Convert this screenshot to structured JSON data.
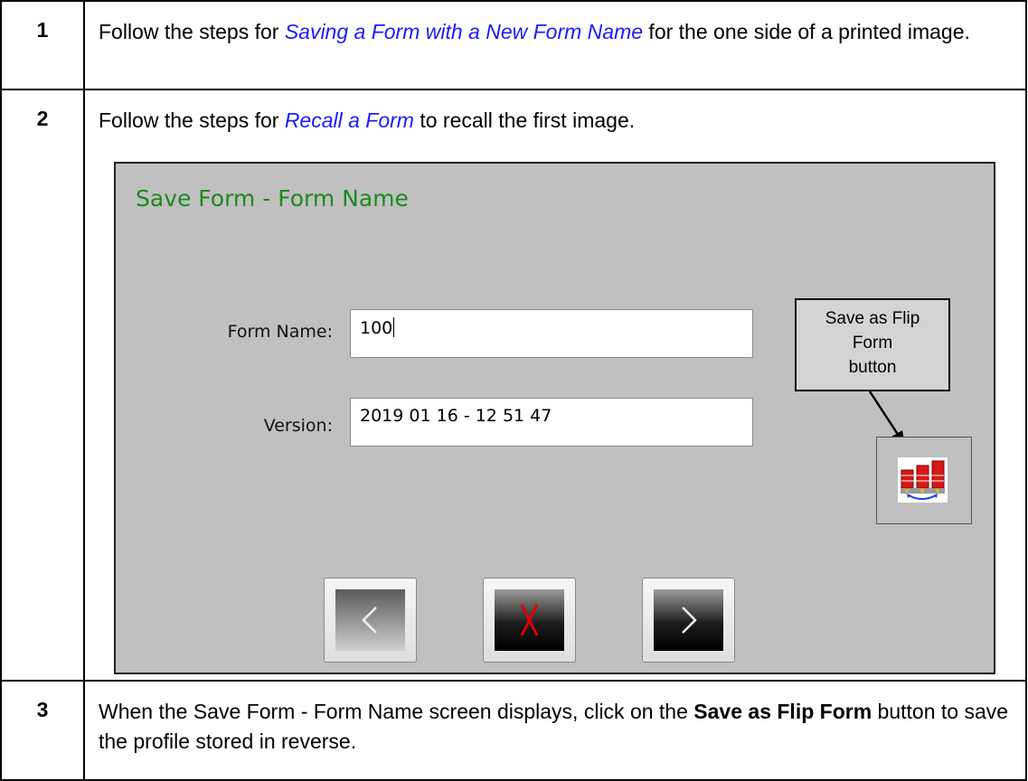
{
  "steps": [
    {
      "number": "1",
      "text_before": "Follow the steps for ",
      "link": "Saving a Form with a New Form Name",
      "text_after": " for the one side of a printed image."
    },
    {
      "number": "2",
      "text_before": "Follow the steps for ",
      "link": "Recall a Form",
      "text_after": " to recall the first image."
    },
    {
      "number": "3",
      "text_before": "When the Save Form - Form Name screen displays, click on the ",
      "bold1": "Save as Flip Form",
      "text_after": " button to save the profile stored in reverse."
    }
  ],
  "screen": {
    "title": "Save Form - Form Name",
    "form_name_label": "Form Name:",
    "form_name_value": "100",
    "version_label": "Version:",
    "version_value": "2019 01 16 - 12 51 47",
    "callout_line1": "Save as Flip",
    "callout_line2": "Form",
    "callout_line3": "button",
    "flip_icon": "flip-form-icon",
    "back_icon": "chevron-left-icon",
    "cancel_icon": "x-icon",
    "next_icon": "chevron-right-icon",
    "colors": {
      "background": "#c0c0c0",
      "title": "#1c8a1c",
      "cancel_x": "#e00000",
      "link": "#1a1aff"
    }
  }
}
